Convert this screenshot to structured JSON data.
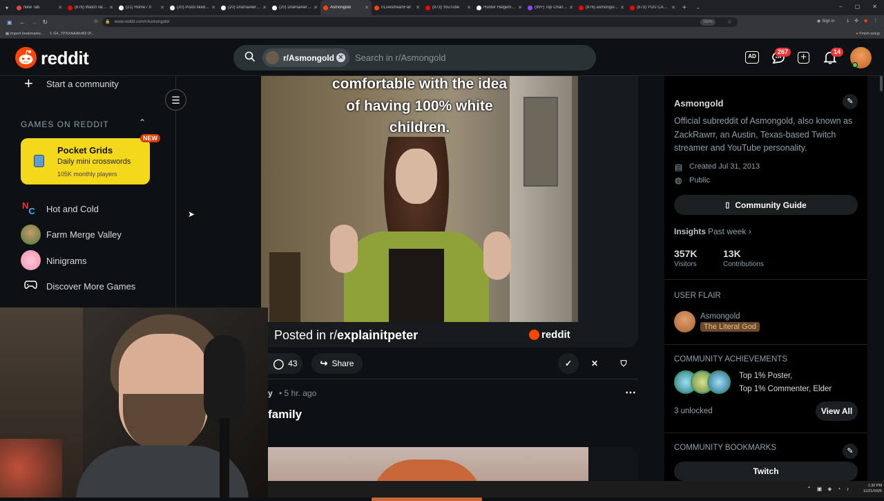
{
  "browser": {
    "tabs": [
      {
        "title": "New Tab",
        "color": "#e8453c"
      },
      {
        "title": "(876) Watch later - Yo",
        "color": "#ff0000"
      },
      {
        "title": "(21) Home / X",
        "color": "#ffffff"
      },
      {
        "title": "(20) Posts liked by Za",
        "color": "#ffffff"
      },
      {
        "title": "(20) DramaAlert on X",
        "color": "#ffffff"
      },
      {
        "title": "(20) DramaAlert on X:",
        "color": "#ffffff"
      },
      {
        "title": "Asmongold",
        "color": "#ff4500"
      },
      {
        "title": "r/LivestreamFail",
        "color": "#ff4500"
      },
      {
        "title": "(873) YouTube",
        "color": "#ff0000"
      },
      {
        "title": "Hunter Helgemo (@T",
        "color": "#ffffff"
      },
      {
        "title": "(99+) Top Channels -",
        "color": "#9146ff"
      },
      {
        "title": "(876) asmongold - Yo",
        "color": "#ff0000"
      },
      {
        "title": "(873) YOU CANNOT",
        "color": "#ff0000"
      }
    ],
    "url": "www.reddit.com/r/Asmongold/",
    "zoom": "150%",
    "sign_in": "Sign in",
    "bookmarks": [
      "Import bookmarks...",
      "G4_7tT6XAAAfvM3 (P..."
    ],
    "finish_setup": "Finish setup"
  },
  "header": {
    "logo_text": "reddit",
    "search_chip": "r/Asmongold",
    "search_placeholder": "Search in r/Asmongold",
    "chat_badge": "267",
    "notif_badge": "14"
  },
  "left_sidebar": {
    "start_community": "Start a community",
    "games_section_title": "GAMES ON REDDIT",
    "featured_game": {
      "title": "Pocket Grids",
      "subtitle": "Daily mini crosswords",
      "players": "105K monthly players",
      "badge": "NEW"
    },
    "games": [
      "Hot and Cold",
      "Farm Merge Valley",
      "Ninigrams",
      "Discover More Games"
    ]
  },
  "post": {
    "caption_lines": [
      "comfortable with the idea",
      "of having 100% white",
      "children."
    ],
    "posted_in_prefix": "Posted in r/",
    "posted_in_sub": "explainitpeter",
    "watermark": "reddit",
    "comments": "43",
    "share": "Share",
    "next_author_tail": "y",
    "next_time": "• 5 hr. ago",
    "next_title": "family"
  },
  "right_sidebar": {
    "name": "Asmongold",
    "description": "Official subreddit of Asmongold, also known as ZackRawrr, an Austin, Texas-based Twitch streamer and YouTube personality.",
    "created": "Created Jul 31, 2013",
    "visibility": "Public",
    "guide_btn": "Community Guide",
    "insights": "Insights",
    "insights_period": "Past week",
    "visitors_value": "357K",
    "visitors_label": "Visitors",
    "contrib_value": "13K",
    "contrib_label": "Contributions",
    "user_flair_title": "USER FLAIR",
    "flair_user": "Asmongold",
    "flair_tag": "The Literal God",
    "achievements_title": "COMMUNITY ACHIEVEMENTS",
    "ach_1": "Top 1% Poster,",
    "ach_2": "Top 1% Commenter, Elder",
    "unlocked": "3 unlocked",
    "view_all": "View All",
    "bookmarks_title": "COMMUNITY BOOKMARKS",
    "twitch_btn": "Twitch"
  },
  "taskbar": {
    "time": "1:32 PM",
    "date": "11/21/2025"
  }
}
